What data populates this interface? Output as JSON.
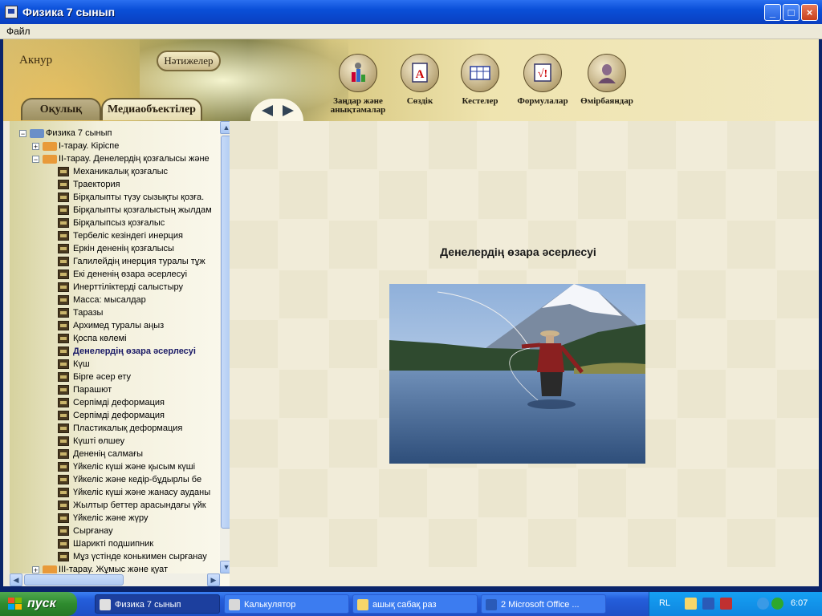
{
  "window": {
    "title": "Физика 7 сынып",
    "buttons": {
      "minimize": "_",
      "maximize": "□",
      "close": "×"
    }
  },
  "menu": {
    "file": "Файл"
  },
  "header": {
    "username": "Акнур",
    "results_button": "Нәтижелер",
    "nav": [
      {
        "label": "Заңдар және анықтамалар",
        "icon": "laws-icon"
      },
      {
        "label": "Сөздік",
        "icon": "dictionary-icon"
      },
      {
        "label": "Кестелер",
        "icon": "tables-icon"
      },
      {
        "label": "Формулалар",
        "icon": "formulas-icon"
      },
      {
        "label": "Өмірбаяндар",
        "icon": "biographies-icon"
      }
    ],
    "tabs": {
      "reading": "Оқулық",
      "media": "Медиаобъектілер"
    }
  },
  "tree": {
    "root": "Физика 7 сынып",
    "items": [
      {
        "label": "I-тарау. Кіріспе",
        "kind": "chapter",
        "expand": "+"
      },
      {
        "label": "II-тарау. Денелердің қозғалысы және",
        "kind": "chapter",
        "expand": "−"
      },
      {
        "label": "Механикалық қозғалыс",
        "kind": "media"
      },
      {
        "label": "Траектория",
        "kind": "media"
      },
      {
        "label": "Бірқалыпты түзу сызықты қозға.",
        "kind": "media"
      },
      {
        "label": "Бірқалыпты қозғалыстың жылдам",
        "kind": "media"
      },
      {
        "label": "Бірқалыпсыз қозғалыс",
        "kind": "media"
      },
      {
        "label": "Тербеліс кезіндегі инерция",
        "kind": "media"
      },
      {
        "label": "Еркін дененің қозғалысы",
        "kind": "media"
      },
      {
        "label": "Галилейдің инерция туралы тұж",
        "kind": "media"
      },
      {
        "label": "Екі дененің өзара әсерлесуі",
        "kind": "media"
      },
      {
        "label": "Инерттіліктерді салыстыру",
        "kind": "media"
      },
      {
        "label": "Масса: мысалдар",
        "kind": "media"
      },
      {
        "label": "Таразы",
        "kind": "media"
      },
      {
        "label": "Архимед туралы аңыз",
        "kind": "media"
      },
      {
        "label": "Қоспа көлемі",
        "kind": "media"
      },
      {
        "label": "Денелердің өзара әсерлесуі",
        "kind": "media",
        "selected": true
      },
      {
        "label": "Күш",
        "kind": "media"
      },
      {
        "label": "Бірге әсер ету",
        "kind": "media"
      },
      {
        "label": "Парашют",
        "kind": "media"
      },
      {
        "label": "Серпімді деформация",
        "kind": "media"
      },
      {
        "label": "Серпімді деформация",
        "kind": "media"
      },
      {
        "label": "Пластикалық деформация",
        "kind": "media"
      },
      {
        "label": "Күшті өлшеу",
        "kind": "media"
      },
      {
        "label": "Дененің салмағы",
        "kind": "media"
      },
      {
        "label": "Үйкеліс күші және қысым күші",
        "kind": "media"
      },
      {
        "label": "Үйкеліс және кедір-бұдырлы бе",
        "kind": "media"
      },
      {
        "label": "Үйкеліс күші және жанасу ауданы",
        "kind": "media"
      },
      {
        "label": "Жылтыр беттер арасындағы үйк",
        "kind": "media"
      },
      {
        "label": "Үйкеліс және жүру",
        "kind": "media"
      },
      {
        "label": "Сырғанау",
        "kind": "media"
      },
      {
        "label": "Шарикті подшипник",
        "kind": "media"
      },
      {
        "label": "Мұз үстінде конькимен сырғанау",
        "kind": "media"
      },
      {
        "label": "III-тарау. Жұмыс және қуат",
        "kind": "chapter",
        "expand": "+"
      }
    ]
  },
  "content": {
    "title": "Денелердің өзара әсерлесуі"
  },
  "taskbar": {
    "start": "пуск",
    "tasks": [
      {
        "label": "Физика 7 сынып",
        "active": true
      },
      {
        "label": "Калькулятор",
        "active": false
      },
      {
        "label": "ашық сабақ раз",
        "active": false
      },
      {
        "label": "2 Microsoft Office ...",
        "active": false
      }
    ],
    "lang": "RL",
    "clock": "6:07"
  },
  "colors": {
    "titlebar": "#0a4fd8",
    "taskbar": "#245edb",
    "start": "#2e8b2e",
    "content_bg": "#f1ecd9"
  }
}
